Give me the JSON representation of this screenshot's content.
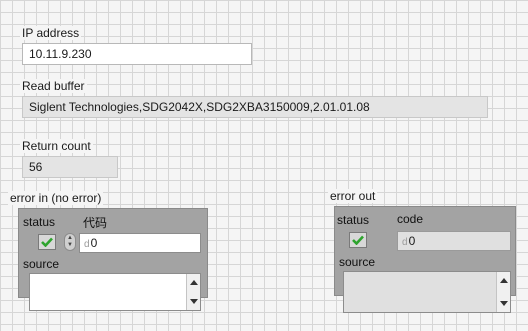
{
  "ip_address": {
    "label": "IP address",
    "value": "10.11.9.230"
  },
  "read_buffer": {
    "label": "Read buffer",
    "value": "Siglent Technologies,SDG2042X,SDG2XBA3150009,2.01.01.08"
  },
  "return_count": {
    "label": "Return count",
    "value": "56"
  },
  "error_in": {
    "title": "error in (no error)",
    "status_label": "status",
    "code_label": "代码",
    "radix": "d",
    "code_value": "0",
    "source_label": "source",
    "source_value": ""
  },
  "error_out": {
    "title": "error out",
    "status_label": "status",
    "code_label": "code",
    "radix": "d",
    "code_value": "0",
    "source_label": "source",
    "source_value": ""
  },
  "icons": {
    "status_true": "check-icon",
    "spin": "increment-decrement-icon",
    "scroll_up": "scroll-up-arrow-icon",
    "scroll_down": "scroll-down-arrow-icon"
  },
  "colors": {
    "check_green": "#2ea42e",
    "cluster_bg": "#a3a3a3"
  }
}
